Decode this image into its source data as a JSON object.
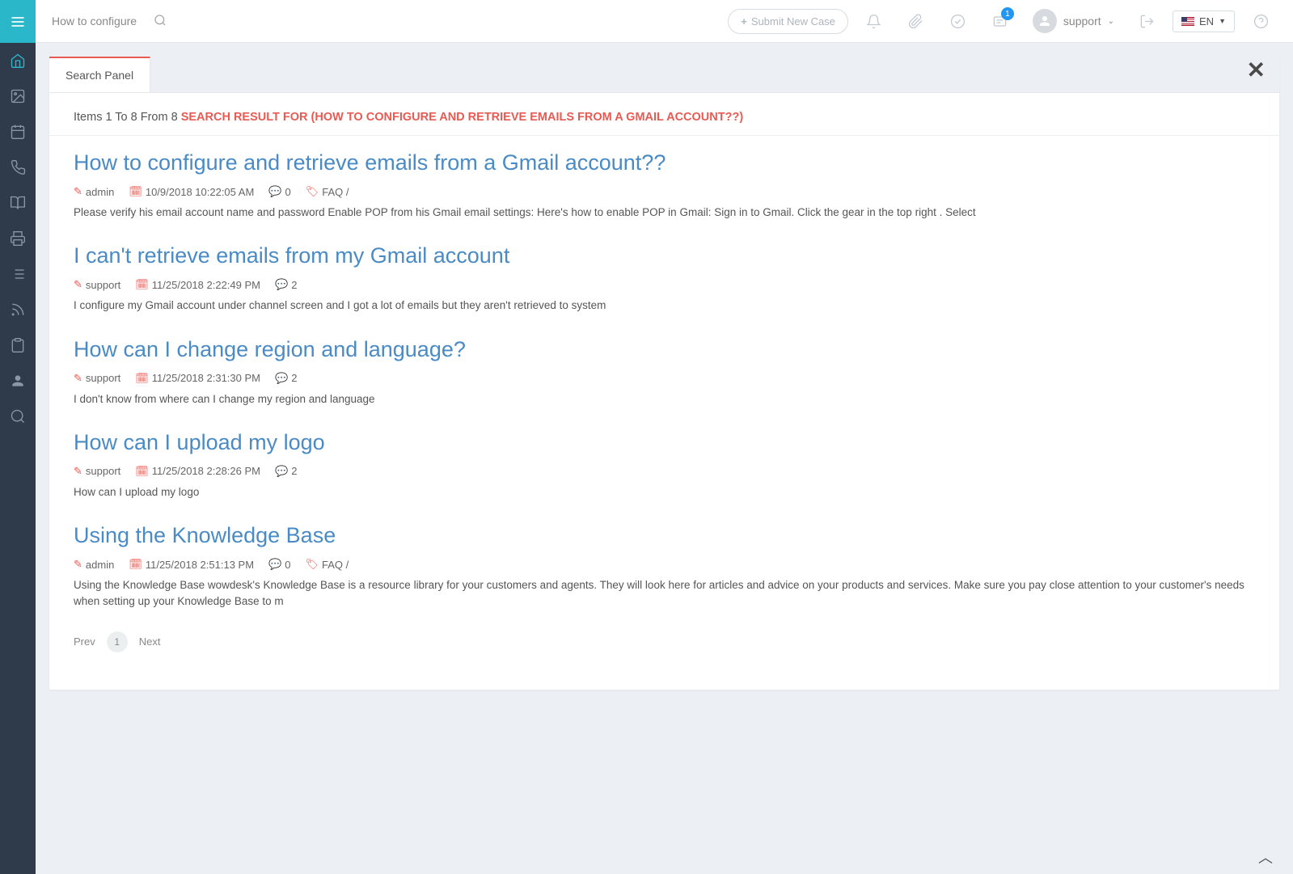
{
  "topbar": {
    "search_value": "How to configure ar",
    "submit_case_label": "Submit New Case",
    "badge_count": "1",
    "username": "support",
    "language": "EN"
  },
  "tabs": {
    "search_panel": "Search Panel"
  },
  "results_header": {
    "prefix": "Items 1 To 8 From 8 ",
    "query": "SEARCH RESULT FOR (HOW TO CONFIGURE AND RETRIEVE EMAILS FROM A GMAIL ACCOUNT??)"
  },
  "results": [
    {
      "title": "How to configure and retrieve emails from a Gmail account??",
      "author": "admin",
      "date": "10/9/2018 10:22:05 AM",
      "comments": "0",
      "tag": "FAQ /",
      "snippet": "Please verify his email account name and password Enable POP from his Gmail email settings:   Here's how to enable POP in Gmail: Sign in to Gmail. Click the gear in the top right . Select"
    },
    {
      "title": "I can't retrieve emails from my Gmail account",
      "author": "support",
      "date": "11/25/2018 2:22:49 PM",
      "comments": "2",
      "tag": "",
      "snippet": "I configure my Gmail account under channel screen and I got a lot of emails but they aren't retrieved to system"
    },
    {
      "title": "How can I change region and language?",
      "author": "support",
      "date": "11/25/2018 2:31:30 PM",
      "comments": "2",
      "tag": "",
      "snippet": "I don't know from where can I change my region and language"
    },
    {
      "title": "How can I upload my logo",
      "author": "support",
      "date": "11/25/2018 2:28:26 PM",
      "comments": "2",
      "tag": "",
      "snippet": "How can I upload my logo"
    },
    {
      "title": "Using the Knowledge Base",
      "author": "admin",
      "date": "11/25/2018 2:51:13 PM",
      "comments": "0",
      "tag": "FAQ /",
      "snippet": "Using the Knowledge Base wowdesk's Knowledge Base is a resource library for your customers and agents. They will look here for articles and advice on your products and services. Make sure you pay close attention to your customer's needs when setting up your Knowledge Base to m"
    }
  ],
  "pagination": {
    "prev": "Prev",
    "page": "1",
    "next": "Next"
  }
}
